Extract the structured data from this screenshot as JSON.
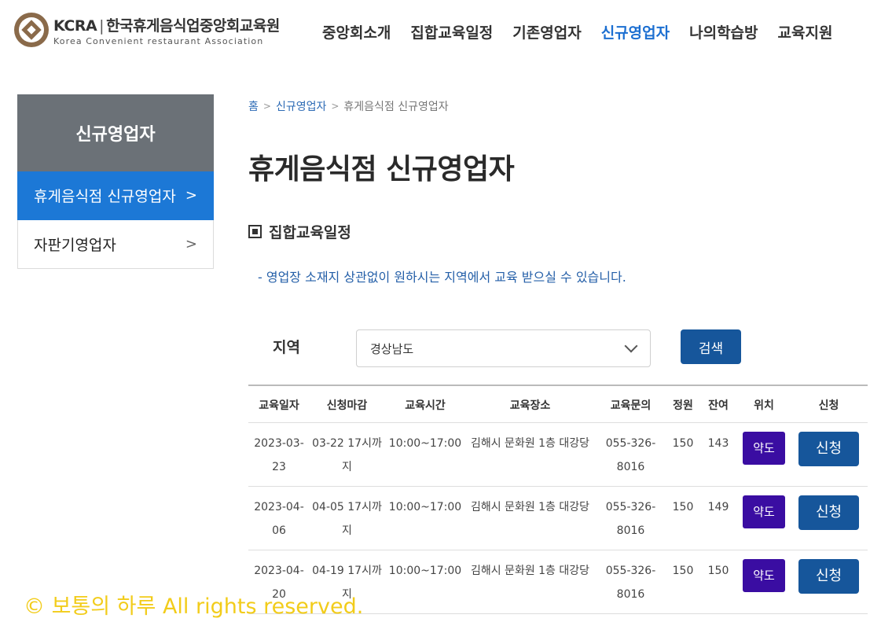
{
  "header": {
    "logo_acronym": "KCRA",
    "logo_name": "한국휴게음식업중앙회교육원",
    "logo_sub": "Korea Convenient restaurant Association",
    "nav": [
      "중앙회소개",
      "집합교육일정",
      "기존영업자",
      "신규영업자",
      "나의학습방",
      "교육지원"
    ],
    "nav_active_index": 3
  },
  "sidebar": {
    "title": "신규영업자",
    "items": [
      {
        "label": "휴게음식점 신규영업자",
        "active": true
      },
      {
        "label": "자판기영업자",
        "active": false
      }
    ]
  },
  "breadcrumb": [
    "홈",
    "신규영업자",
    "휴게음식점 신규영업자"
  ],
  "page_title": "휴게음식점 신규영업자",
  "section_title": "집합교육일정",
  "notice": "- 영업장 소재지 상관없이 원하시는 지역에서 교육 받으실 수 있습니다.",
  "search": {
    "label": "지역",
    "selected": "경상남도",
    "button": "검색"
  },
  "table": {
    "headers": [
      "교육일자",
      "신청마감",
      "교육시간",
      "교육장소",
      "교육문의",
      "정원",
      "잔여",
      "위치",
      "신청"
    ],
    "rows": [
      {
        "date": "2023-03-23",
        "deadline": "03-22 17시까지",
        "time": "10:00~17:00",
        "place": "김해시 문화원 1층 대강당",
        "contact": "055-326-8016",
        "capacity": "150",
        "remaining": "143",
        "map": "약도",
        "apply": "신청"
      },
      {
        "date": "2023-04-06",
        "deadline": "04-05 17시까지",
        "time": "10:00~17:00",
        "place": "김해시 문화원 1층 대강당",
        "contact": "055-326-8016",
        "capacity": "150",
        "remaining": "149",
        "map": "약도",
        "apply": "신청"
      },
      {
        "date": "2023-04-20",
        "deadline": "04-19 17시까지",
        "time": "10:00~17:00",
        "place": "김해시 문화원 1층 대강당",
        "contact": "055-326-8016",
        "capacity": "150",
        "remaining": "150",
        "map": "약도",
        "apply": "신청"
      }
    ]
  },
  "watermark": "© 보통의 하루 All rights reserved.",
  "colors": {
    "accent": "#1c6fd1",
    "button": "#16569b",
    "map_button": "#3a0da2",
    "sidebar_title_bg": "#6b7177",
    "sidebar_active_bg": "#1c78d6",
    "watermark": "#f2cc1a"
  }
}
